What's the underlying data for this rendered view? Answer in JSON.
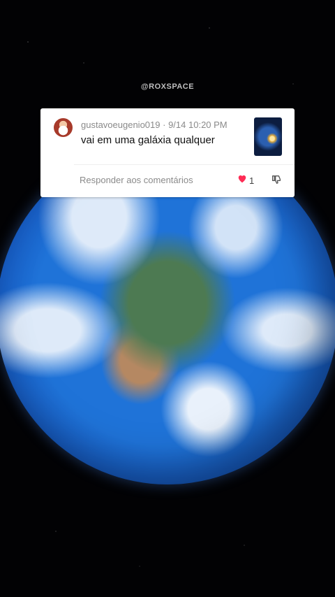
{
  "watermark": "@ROXSPACE",
  "comment": {
    "username": "gustavoeugenio019",
    "timestamp": "9/14 10:20 PM",
    "text": "vai em uma galáxia qualquer",
    "reply_label": "Responder aos comentários",
    "like_count": "1"
  },
  "colors": {
    "heart": "#fe2c55",
    "meta_text": "#8a8a8a"
  }
}
